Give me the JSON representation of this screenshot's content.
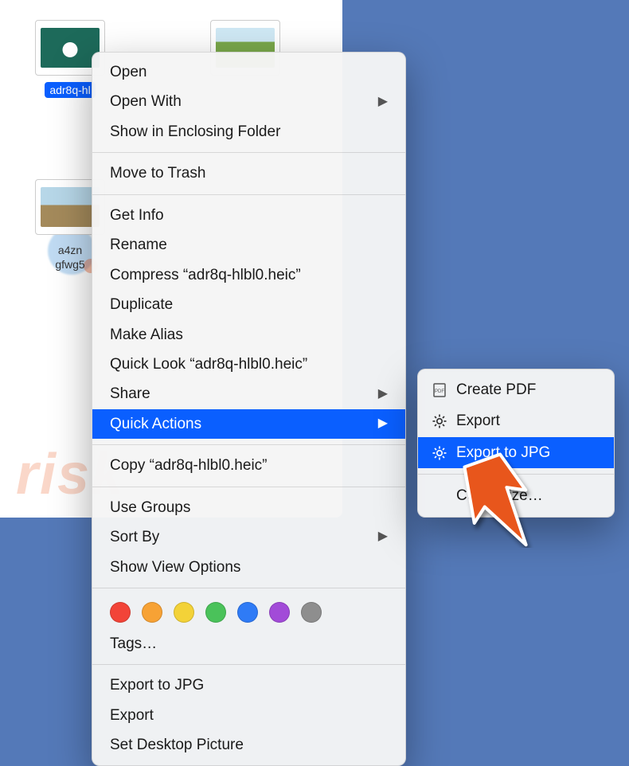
{
  "files": {
    "f1_name": "adr8q-hl",
    "f2_name": "",
    "f3_line1": "a4zn",
    "f3_line2": "gfwg5"
  },
  "menu": {
    "open": "Open",
    "open_with": "Open With",
    "show_in_enclosing": "Show in Enclosing Folder",
    "move_to_trash": "Move to Trash",
    "get_info": "Get Info",
    "rename": "Rename",
    "compress": "Compress “adr8q-hlbl0.heic”",
    "duplicate": "Duplicate",
    "make_alias": "Make Alias",
    "quick_look": "Quick Look “adr8q-hlbl0.heic”",
    "share": "Share",
    "quick_actions": "Quick Actions",
    "copy": "Copy “adr8q-hlbl0.heic”",
    "use_groups": "Use Groups",
    "sort_by": "Sort By",
    "show_view_options": "Show View Options",
    "tags_label": "Tags…",
    "export_to_jpg": "Export to JPG",
    "export": "Export",
    "set_desktop_picture": "Set Desktop Picture"
  },
  "submenu": {
    "create_pdf": "Create PDF",
    "export": "Export",
    "export_to_jpg": "Export to JPG",
    "customize": "Customize…"
  },
  "tag_colors": {
    "c1": "#f24438",
    "c2": "#f7a235",
    "c3": "#f3d238",
    "c4": "#4ac25a",
    "c5": "#2f7bf6",
    "c6": "#a24bd8",
    "c7": "#8e8e8e"
  },
  "watermark": "risk"
}
